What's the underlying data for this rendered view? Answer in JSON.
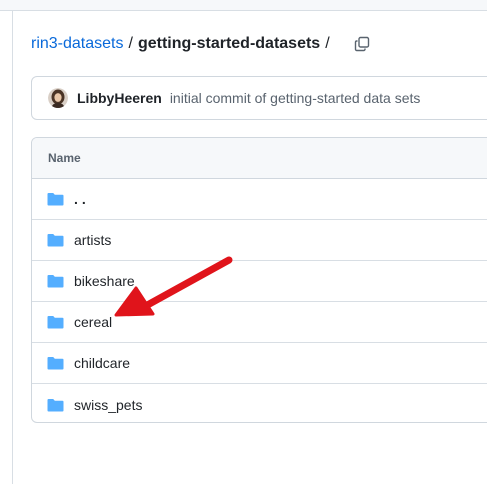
{
  "breadcrumb": {
    "repo_link": "rin3-datasets",
    "separator": "/",
    "current": "getting-started-datasets",
    "trailing_separator": "/",
    "copy_icon": "copy-icon"
  },
  "commit": {
    "author": "LibbyHeeren",
    "message": "initial commit of getting-started data sets",
    "avatar_icon": "avatar"
  },
  "table": {
    "header_name": "Name",
    "rows": [
      {
        "name": "..",
        "icon": "folder-icon"
      },
      {
        "name": "artists",
        "icon": "folder-icon"
      },
      {
        "name": "bikeshare",
        "icon": "folder-icon"
      },
      {
        "name": "cereal",
        "icon": "folder-icon"
      },
      {
        "name": "childcare",
        "icon": "folder-icon"
      },
      {
        "name": "swiss_pets",
        "icon": "folder-icon"
      }
    ]
  },
  "annotation": {
    "arrow_color": "#e0141b",
    "points_to": "cereal"
  },
  "colors": {
    "link": "#0969da",
    "folder": "#54aeff",
    "border": "#d0d7de",
    "header_bg": "#f6f8fa"
  }
}
